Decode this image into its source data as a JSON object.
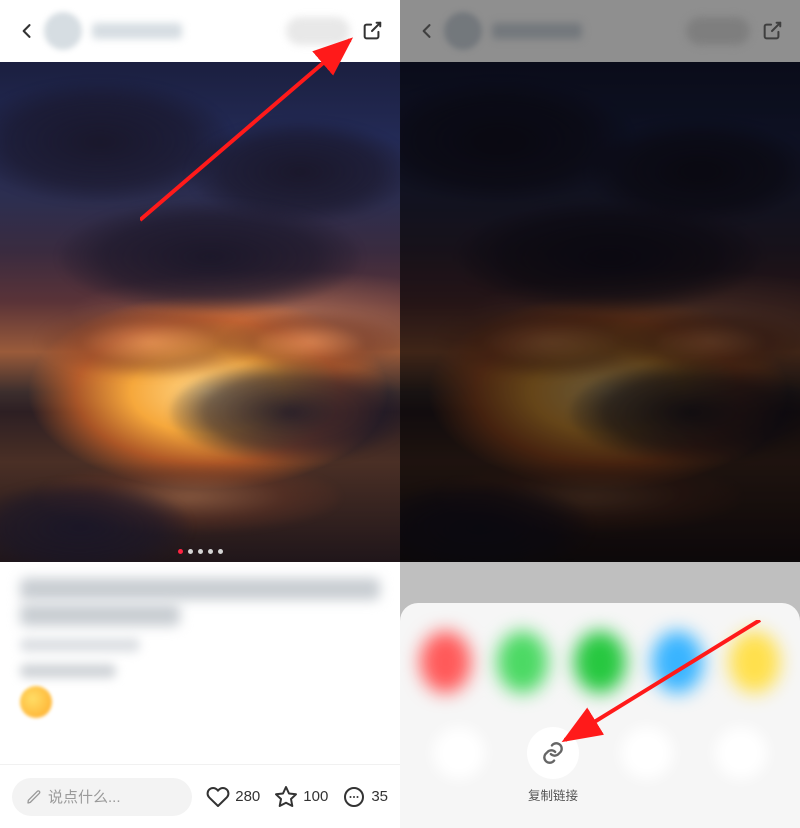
{
  "left": {
    "compose_placeholder": "说点什么...",
    "like_count": "280",
    "star_count": "100",
    "comment_count": "35",
    "pager_active_index": 0,
    "pager_total": 5
  },
  "right": {
    "action_copy_link_label": "复制链接"
  },
  "icons": {
    "back": "chevron-left-icon",
    "share": "external-link-icon",
    "pen": "pen-icon",
    "heart": "heart-icon",
    "star": "star-icon",
    "comment": "comment-icon",
    "link": "link-icon"
  },
  "arrow_color": "#ff1a1a"
}
